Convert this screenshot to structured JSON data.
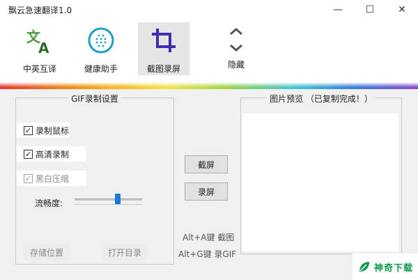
{
  "window": {
    "title": "飘云急速翻译1.0",
    "minimize_glyph": "—",
    "maximize_glyph": "☐",
    "close_glyph": "✕"
  },
  "toolbar": {
    "items": [
      {
        "label": "中英互译",
        "icon": "translate-icon",
        "color": "#4a9a3a"
      },
      {
        "label": "健康助手",
        "icon": "health-circle-icon",
        "color": "#1a9fc9"
      },
      {
        "label": "截图录屏",
        "icon": "crop-icon",
        "color": "#3b2fb0",
        "active": true
      },
      {
        "label": "隐藏",
        "icon": "chevron-up-down-icon",
        "color": "#555555"
      }
    ]
  },
  "gif_settings": {
    "title": "GIF录制设置",
    "options": [
      {
        "label": "录制鼠标",
        "checked": true,
        "enabled": true
      },
      {
        "label": "高清录制",
        "checked": true,
        "enabled": true
      },
      {
        "label": "黑白压缩",
        "checked": true,
        "enabled": false
      }
    ],
    "fluency_label": "流畅度:",
    "fluency_value": 0.65,
    "store_button": "存储位置",
    "open_dir_button": "打开目录"
  },
  "actions": {
    "screenshot_button": "截屏",
    "record_button": "录屏",
    "hotkey_screenshot": "Alt+A键 截图",
    "hotkey_gif": "Alt+G键 录GIF"
  },
  "preview": {
    "title": "图片预览 （已复制完成！）"
  },
  "watermark": {
    "text": "神奇下载",
    "color": "#0a9a4a"
  }
}
